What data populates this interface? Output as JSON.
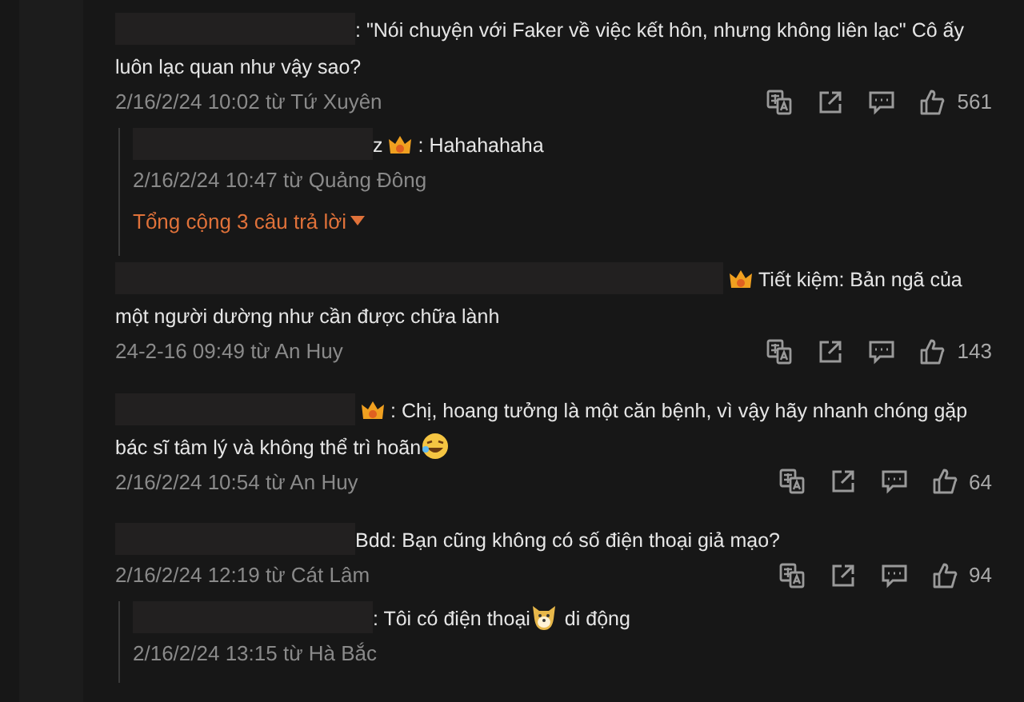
{
  "items": [
    {
      "kind": "comment",
      "segments": [
        {
          "kind": "redacted"
        },
        {
          "kind": "text",
          "text": ": \"Nói chuyện với Faker về việc kết hôn, nhưng không liên lạc\" Cô ấy luôn lạc quan như vậy sao?"
        }
      ],
      "meta": "2/16/2/24 10:02 từ Tứ Xuyên",
      "likes": "561"
    },
    {
      "kind": "reply",
      "segments": [
        {
          "kind": "redacted"
        },
        {
          "kind": "text",
          "text": "z"
        },
        {
          "kind": "crown"
        },
        {
          "kind": "text",
          "text": ": Hahahahaha"
        }
      ],
      "meta": "2/16/2/24 10:47 từ Quảng Đông"
    },
    {
      "kind": "more",
      "text": "Tổng cộng 3 câu trả lời"
    },
    {
      "kind": "comment",
      "segments": [
        {
          "kind": "redacted",
          "wide": true
        },
        {
          "kind": "crown"
        },
        {
          "kind": "text",
          "text": "Tiết kiệm: Bản ngã của một người dường như cần được chữa lành"
        }
      ],
      "meta": "24-2-16 09:49 từ An Huy",
      "likes": "143"
    },
    {
      "kind": "comment",
      "segments": [
        {
          "kind": "redacted"
        },
        {
          "kind": "crown"
        },
        {
          "kind": "text",
          "text": ": Chị, hoang tưởng là một căn bệnh, vì vậy hãy nhanh chóng gặp bác sĩ tâm lý và không thể trì hoãn"
        },
        {
          "kind": "laugh"
        }
      ],
      "meta": "2/16/2/24 10:54 từ An Huy",
      "likes": "64"
    },
    {
      "kind": "comment",
      "segments": [
        {
          "kind": "redacted"
        },
        {
          "kind": "text",
          "text": "Bdd: Bạn cũng không có số điện thoại giả mạo?"
        }
      ],
      "meta": "2/16/2/24 12:19 từ Cát Lâm",
      "likes": "94"
    },
    {
      "kind": "reply",
      "segments": [
        {
          "kind": "redacted"
        },
        {
          "kind": "text",
          "text": ": Tôi có điện thoại"
        },
        {
          "kind": "dog"
        },
        {
          "kind": "text",
          "text": " di động"
        }
      ],
      "meta": "2/16/2/24 13:15 từ Hà Bắc"
    }
  ]
}
